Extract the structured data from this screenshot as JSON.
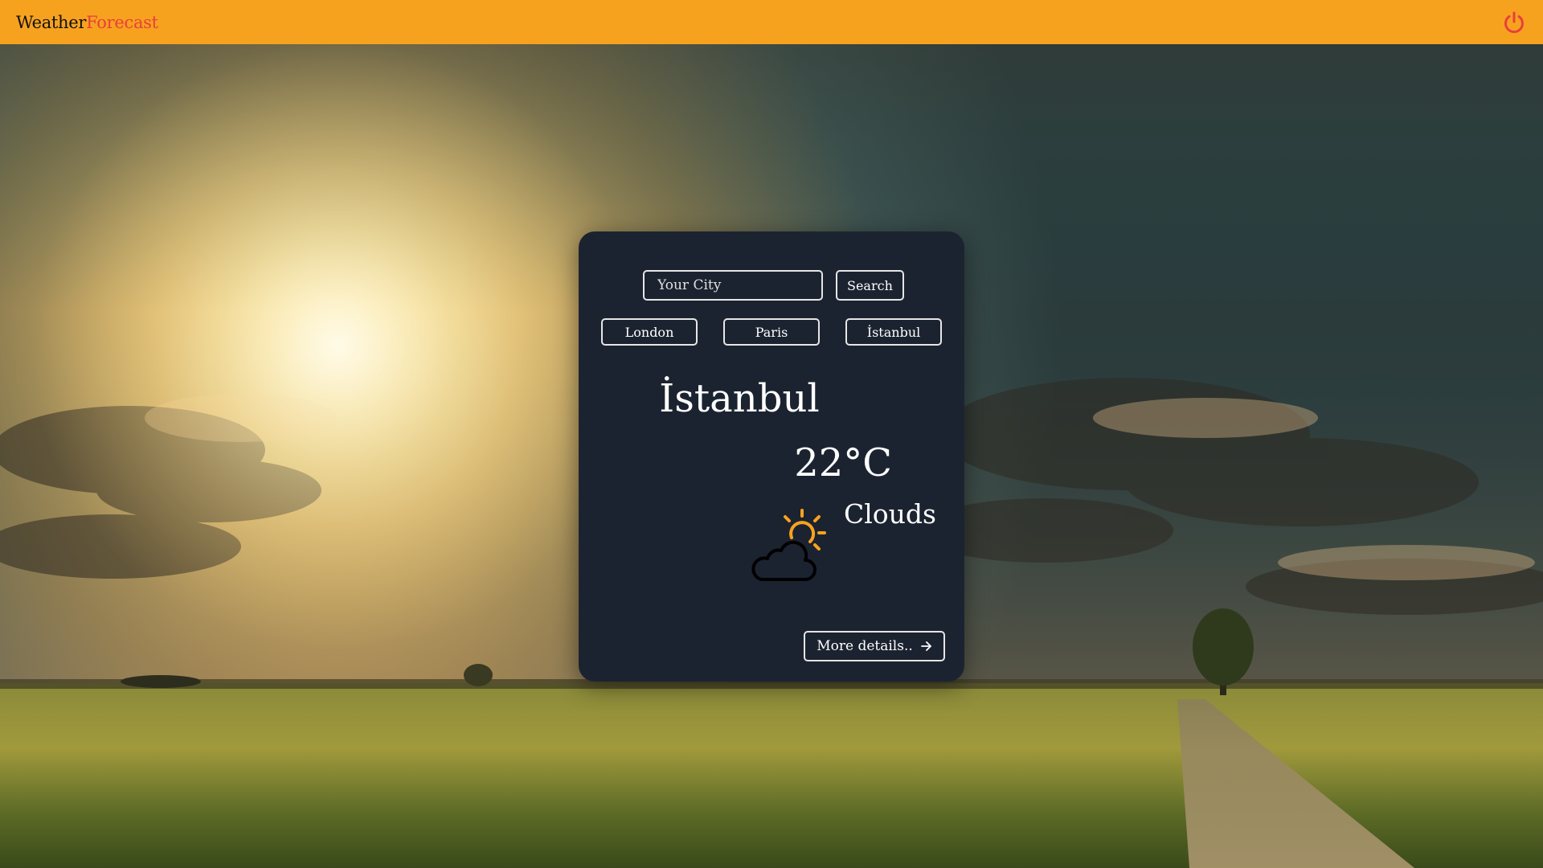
{
  "app": {
    "brand_part1": "Weather",
    "brand_part2": "Forecast",
    "power_icon": "power-icon"
  },
  "search": {
    "placeholder": "Your City",
    "value": "",
    "button_label": "Search"
  },
  "quick_cities": [
    {
      "label": "London"
    },
    {
      "label": "Paris"
    },
    {
      "label": "İstanbul"
    }
  ],
  "weather": {
    "city": "İstanbul",
    "temperature": "22°C",
    "condition": "Clouds",
    "condition_icon": "partly-cloudy-icon"
  },
  "more_details": {
    "label": "More details..",
    "icon": "arrow-right-icon"
  },
  "colors": {
    "topbar": "#f7a21f",
    "brand_primary": "#111111",
    "brand_accent": "#e8403a",
    "card_bg": "#1c2330",
    "sun": "#f7a21f"
  }
}
